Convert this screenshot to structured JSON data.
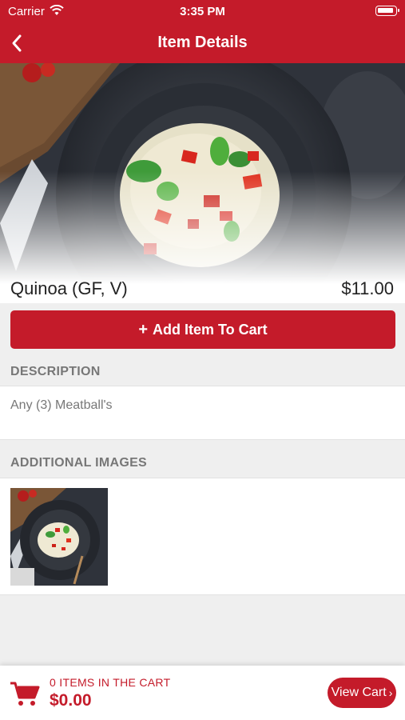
{
  "status_bar": {
    "carrier": "Carrier",
    "time": "3:35 PM"
  },
  "nav": {
    "title": "Item Details",
    "back_icon": "chevron-left-icon"
  },
  "item": {
    "name": "Quinoa (GF, V)",
    "price": "$11.00"
  },
  "add_button": {
    "plus": "+",
    "label": "Add Item To Cart"
  },
  "description": {
    "header": "DESCRIPTION",
    "text": "Any (3) Meatball's"
  },
  "additional_images": {
    "header": "ADDITIONAL IMAGES"
  },
  "cart": {
    "items_label": "0 ITEMS IN THE CART",
    "total": "$0.00",
    "view_cart_label": "View Cart",
    "view_cart_chevron": "›"
  },
  "colors": {
    "brand": "#c41b2a",
    "background": "#efefef"
  }
}
